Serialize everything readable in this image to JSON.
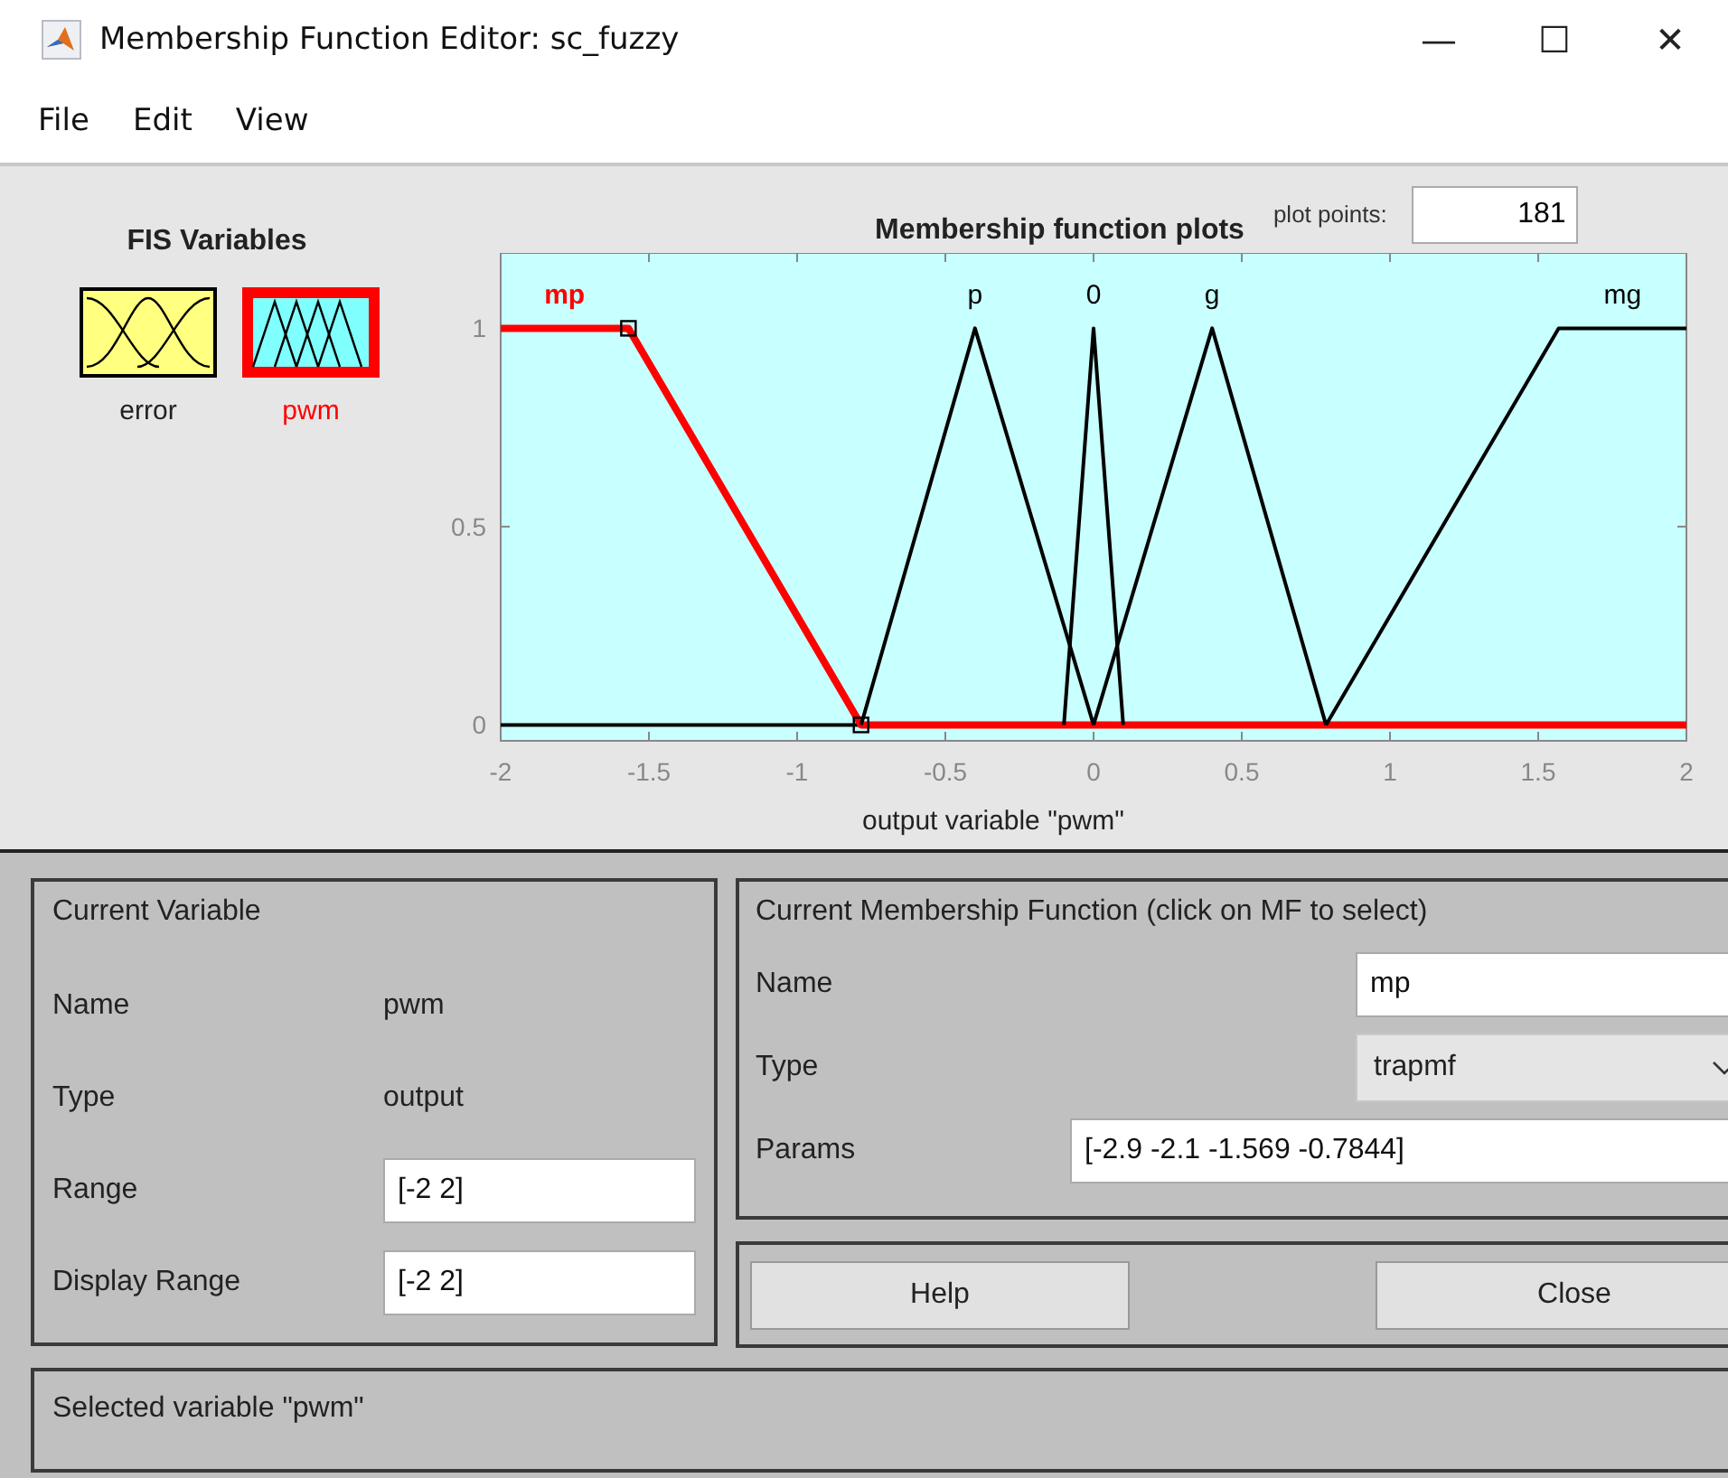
{
  "window": {
    "title": "Membership Function Editor: sc_fuzzy",
    "controls": [
      "—",
      "☐",
      "✕"
    ]
  },
  "menu": [
    "File",
    "Edit",
    "View"
  ],
  "fis_variables": {
    "title": "FIS Variables",
    "items": [
      {
        "name": "error",
        "kind": "input",
        "selected": false
      },
      {
        "name": "pwm",
        "kind": "output",
        "selected": true
      }
    ]
  },
  "plot": {
    "title": "Membership function plots",
    "plot_points_label": "plot points:",
    "plot_points": "181",
    "chart_data": {
      "type": "line",
      "xlabel": "output variable \"pwm\"",
      "x": [
        -2,
        -1.569,
        -0.7844,
        -0.4,
        -0.1,
        0,
        0.1,
        0.4,
        0.7844,
        1.569,
        2
      ],
      "xlim": [
        -2,
        2
      ],
      "ylim": [
        -0.04,
        1.19
      ],
      "xticks": [
        -2,
        -1.5,
        -1,
        -0.5,
        0,
        0.5,
        1,
        1.5,
        2
      ],
      "yticks": [
        0,
        0.5,
        1
      ],
      "series": [
        {
          "name": "mp",
          "color": "#ff0000",
          "values": [
            1,
            1,
            0,
            0,
            0,
            0,
            0,
            0,
            0,
            0,
            0
          ]
        },
        {
          "name": "p",
          "color": "#000000",
          "values": [
            null,
            null,
            0,
            1,
            0.25,
            0,
            null,
            null,
            null,
            null,
            null
          ]
        },
        {
          "name": "0",
          "color": "#000000",
          "values": [
            null,
            null,
            null,
            null,
            0,
            1,
            0,
            null,
            null,
            null,
            null
          ]
        },
        {
          "name": "g",
          "color": "#000000",
          "values": [
            null,
            null,
            null,
            null,
            null,
            0,
            0.25,
            1,
            0,
            null,
            null
          ]
        },
        {
          "name": "mg",
          "color": "#000000",
          "values": [
            null,
            null,
            null,
            null,
            null,
            null,
            null,
            null,
            0,
            1,
            1
          ]
        }
      ]
    },
    "curve_states": [
      {
        "selected": true
      },
      {
        "selected": false
      },
      {
        "selected": false
      },
      {
        "selected": false
      },
      {
        "selected": false
      }
    ]
  },
  "current_variable": {
    "title": "Current Variable",
    "rows": [
      {
        "label": "Name",
        "value": "pwm",
        "kind": "text"
      },
      {
        "label": "Type",
        "value": "output",
        "kind": "text"
      },
      {
        "label": "Range",
        "value": "[-2 2]",
        "kind": "field"
      },
      {
        "label": "Display Range",
        "value": "[-2 2]",
        "kind": "field"
      }
    ]
  },
  "current_mf": {
    "title": "Current Membership Function (click on MF to select)",
    "name_label": "Name",
    "name": "mp",
    "type_label": "Type",
    "type": "trapmf",
    "params_label": "Params",
    "params": "[-2.9 -2.1 -1.569 -0.7844]"
  },
  "buttons": [
    "Help",
    "Close"
  ],
  "status": "Selected variable \"pwm\""
}
